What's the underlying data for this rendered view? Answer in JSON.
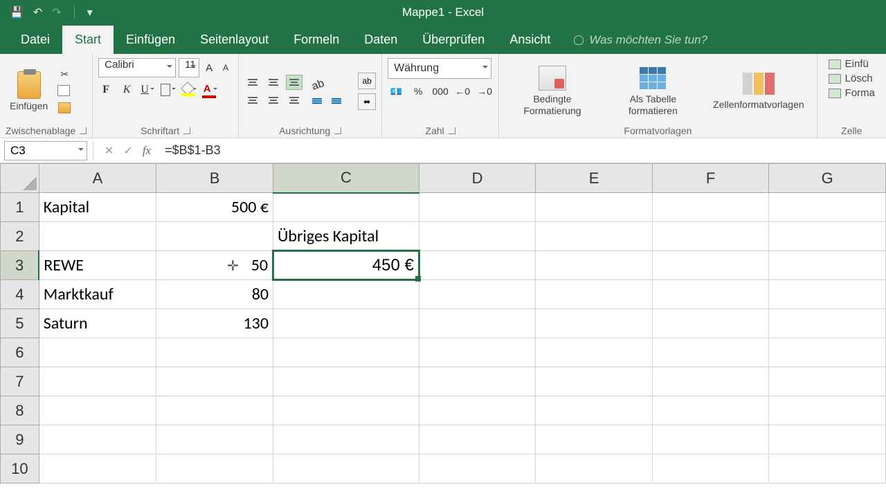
{
  "titlebar": {
    "doc_title": "Mappe1 - Excel"
  },
  "tabs": {
    "file": "Datei",
    "home": "Start",
    "insert": "Einfügen",
    "pagelayout": "Seitenlayout",
    "formulas": "Formeln",
    "data": "Daten",
    "review": "Überprüfen",
    "view": "Ansicht",
    "tellme": "Was möchten Sie tun?"
  },
  "ribbon": {
    "clipboard": {
      "label": "Zwischenablage",
      "paste": "Einfügen"
    },
    "font": {
      "label": "Schriftart",
      "name": "Calibri",
      "size": "11"
    },
    "alignment": {
      "label": "Ausrichtung"
    },
    "number": {
      "label": "Zahl",
      "format": "Währung",
      "percent": "%",
      "thousands": "000"
    },
    "styles": {
      "label": "Formatvorlagen",
      "cond_fmt": "Bedingte Formatierung",
      "as_table": "Als Tabelle formatieren",
      "cell_styles": "Zellenformatvorlagen"
    },
    "cells": {
      "label": "Zelle",
      "insert": "Einfü",
      "delete": "Lösch",
      "format": "Forma"
    }
  },
  "formula_bar": {
    "cell_ref": "C3",
    "formula": "=$B$1-B3"
  },
  "sheet": {
    "columns": [
      "A",
      "B",
      "C",
      "D",
      "E",
      "F",
      "G"
    ],
    "rows": [
      "1",
      "2",
      "3",
      "4",
      "5",
      "6",
      "7",
      "8",
      "9",
      "10"
    ],
    "selected_col": "C",
    "selected_row": "3",
    "cells": {
      "A1": "Kapital",
      "B1": "500 €",
      "C2": "Übriges Kapital",
      "A3": "REWE",
      "B3": "50",
      "C3": "450 €",
      "A4": "Marktkauf",
      "B4": "80",
      "A5": "Saturn",
      "B5": "130"
    }
  }
}
